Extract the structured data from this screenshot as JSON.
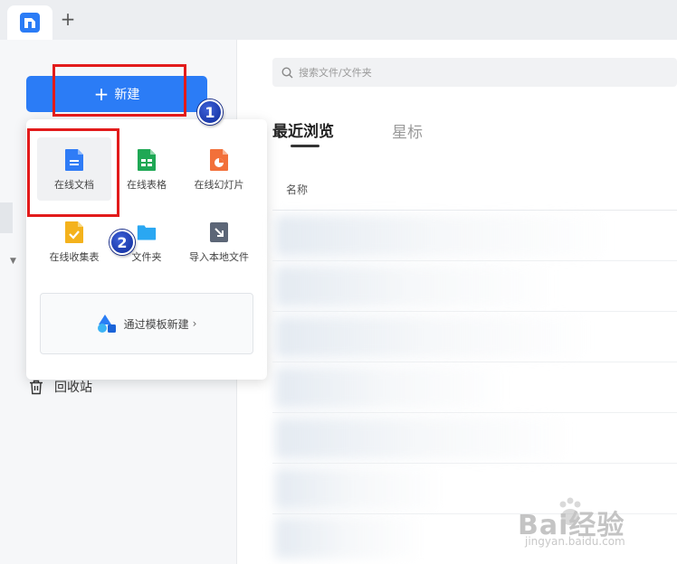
{
  "tabbar": {
    "new_tab_icon": "+"
  },
  "sidebar": {
    "new_button_label": "新建",
    "trash_label": "回收站"
  },
  "dropdown": {
    "options": [
      {
        "label": "在线文档",
        "icon": "doc-icon",
        "color": "#2f7cf6"
      },
      {
        "label": "在线表格",
        "icon": "sheet-icon",
        "color": "#1fa855"
      },
      {
        "label": "在线幻灯片",
        "icon": "slides-icon",
        "color": "#f2703a"
      },
      {
        "label": "在线收集表",
        "icon": "form-icon",
        "color": "#f4b21c"
      },
      {
        "label": "文件夹",
        "icon": "folder-icon",
        "color": "#2aa7f2"
      },
      {
        "label": "导入本地文件",
        "icon": "import-icon",
        "color": "#5c6677"
      }
    ],
    "template_label": "通过模板新建",
    "template_chevron": "›"
  },
  "annotations": {
    "step1": "1",
    "step2": "2"
  },
  "main": {
    "search_placeholder": "搜索文件/文件夹",
    "tabs": [
      "最近浏览",
      "星标"
    ],
    "column_name": "名称"
  },
  "watermark": {
    "text": "Bai经验",
    "sub": "jingyan.baidu.com"
  },
  "colors": {
    "accent": "#2b7cf6",
    "annotation_red": "#e21b1b",
    "badge_blue": "#0d2a9a"
  }
}
